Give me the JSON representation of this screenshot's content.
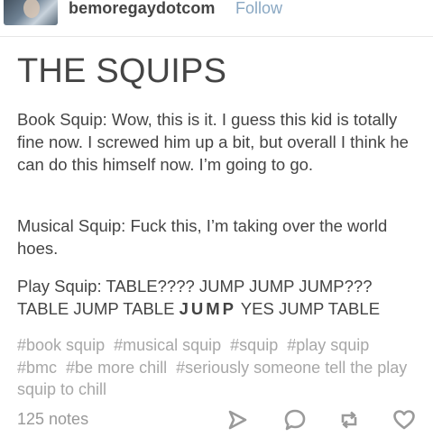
{
  "header": {
    "username": "bemoregaydotcom",
    "follow_label": "Follow"
  },
  "post": {
    "title": "THE SQUIPS",
    "paragraphs": {
      "p1": "Book Squip: Wow, this is it. I guess this kid is totally fine now. I screwed him up a bit, but overall I think he can do this himself now. I’m going to go.",
      "p2": "Musical Squip: Fuck this, I’m taking over the world hoes.",
      "p3_before": "Play Squip: TABLE???? JUMP JUMP JUMP??? TABLE JUMP TABLE ",
      "p3_bold": "JUMP",
      "p3_after": " YES JUMP TABLE"
    },
    "tags": [
      "#book squip",
      "#musical squip",
      "#squip",
      "#play squip",
      "#bmc",
      "#be more chill",
      "#seriously someone tell the play squip to chill"
    ]
  },
  "footer": {
    "notes": "125 notes",
    "icons": [
      "share-icon",
      "reply-icon",
      "reblog-icon",
      "heart-icon"
    ]
  },
  "colors": {
    "text": "#444444",
    "follow": "#8aa8c3",
    "tags": "#a7a7a7",
    "icons": "#9a9a9a"
  }
}
